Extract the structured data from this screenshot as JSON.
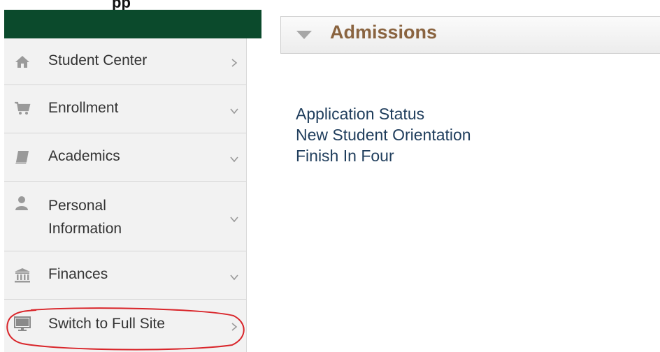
{
  "header": {
    "title_fragment": "pp"
  },
  "sidebar": {
    "items": [
      {
        "label": "Student Center",
        "icon": "home-icon",
        "chevron": "chevron-right-icon"
      },
      {
        "label": "Enrollment",
        "icon": "cart-icon",
        "chevron": "chevron-down-icon"
      },
      {
        "label": "Academics",
        "icon": "book-icon",
        "chevron": "chevron-down-icon"
      },
      {
        "label_line1": "Personal",
        "label_line2": "Information",
        "icon": "person-icon",
        "chevron": "chevron-down-icon"
      },
      {
        "label": "Finances",
        "icon": "bank-icon",
        "chevron": "chevron-down-icon"
      },
      {
        "label": "Switch to Full Site",
        "icon": "monitor-icon",
        "chevron": "chevron-right-icon"
      }
    ]
  },
  "main": {
    "section_title": "Admissions",
    "links": [
      "Application Status",
      "New Student Orientation",
      "Finish In Four"
    ]
  },
  "colors": {
    "brand_bar": "#0b4a2c",
    "section_title": "#8a6440",
    "link": "#1f3d5c",
    "annotation_circle": "#d9262b"
  }
}
